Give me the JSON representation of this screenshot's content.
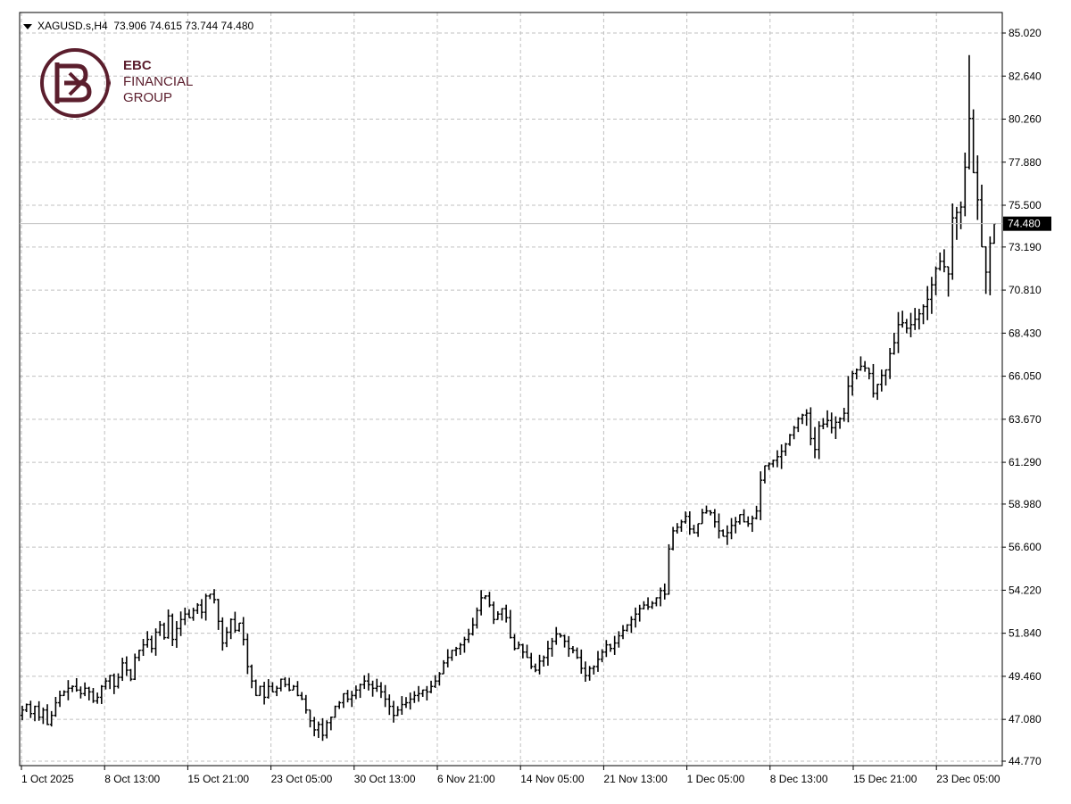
{
  "header": {
    "symbol": "XAGUSD.s,H4",
    "ohlc": "73.906 74.615 73.744 74.480"
  },
  "logo": {
    "line1": "EBC",
    "line2": "FINANCIAL",
    "line3": "GROUP",
    "color": "#5b1e2d"
  },
  "colors": {
    "bars": "#000000",
    "grid": "#c0c0c0",
    "price_line": "#c0c0c0",
    "price_label_bg": "#000000",
    "price_label_fg": "#ffffff"
  },
  "chart_data": {
    "type": "ohlc",
    "symbol": "XAGUSD.s",
    "timeframe": "H4",
    "ylim": [
      44.77,
      85.02
    ],
    "y_ticks": [
      "85.020",
      "82.640",
      "80.260",
      "77.880",
      "75.500",
      "73.190",
      "70.810",
      "68.430",
      "66.050",
      "63.670",
      "61.290",
      "58.980",
      "56.600",
      "54.220",
      "51.840",
      "49.460",
      "47.080",
      "44.770"
    ],
    "x_ticks": [
      "1 Oct 2025",
      "8 Oct 13:00",
      "15 Oct 21:00",
      "23 Oct 05:00",
      "30 Oct 13:00",
      "6 Nov 21:00",
      "14 Nov 05:00",
      "21 Nov 13:00",
      "1 Dec 05:00",
      "8 Dec 13:00",
      "15 Dec 21:00",
      "23 Dec 05:00"
    ],
    "current_price": "74.480",
    "grid": true,
    "closes": [
      47.6,
      47.9,
      47.4,
      47.8,
      47.2,
      47.6,
      46.8,
      47.3,
      48.0,
      48.4,
      48.6,
      48.8,
      48.9,
      48.7,
      48.5,
      48.8,
      48.6,
      48.1,
      48.3,
      48.9,
      49.2,
      49.5,
      48.9,
      49.4,
      50.2,
      49.8,
      49.3,
      50.5,
      50.9,
      51.2,
      51.5,
      51.0,
      51.9,
      52.3,
      51.6,
      52.8,
      51.5,
      52.1,
      52.6,
      52.9,
      52.7,
      53.1,
      53.4,
      53.0,
      53.9,
      54.0,
      53.7,
      52.5,
      51.3,
      51.9,
      52.6,
      52.0,
      52.4,
      51.5,
      50.0,
      49.2,
      48.4,
      48.9,
      48.3,
      48.9,
      48.6,
      48.8,
      49.3,
      49.0,
      48.7,
      48.9,
      48.4,
      48.2,
      47.6,
      47.0,
      46.5,
      46.8,
      46.2,
      46.9,
      47.2,
      47.8,
      48.0,
      48.5,
      48.2,
      48.4,
      48.7,
      49.0,
      49.2,
      49.0,
      48.8,
      48.9,
      48.6,
      48.2,
      47.8,
      47.3,
      47.6,
      47.9,
      48.0,
      48.2,
      48.4,
      48.5,
      48.7,
      48.6,
      48.9,
      49.2,
      49.6,
      50.2,
      50.5,
      50.9,
      51.0,
      51.2,
      51.5,
      51.8,
      52.3,
      53.1,
      53.8,
      53.9,
      53.4,
      52.6,
      52.9,
      53.2,
      52.7,
      51.6,
      51.0,
      51.2,
      50.8,
      50.5,
      50.0,
      49.8,
      50.3,
      50.5,
      51.0,
      51.4,
      51.8,
      51.7,
      51.4,
      51.0,
      50.9,
      50.5,
      49.9,
      49.5,
      49.9,
      50.0,
      50.4,
      50.8,
      51.2,
      51.0,
      51.3,
      51.7,
      52.0,
      52.3,
      52.6,
      52.9,
      53.2,
      53.4,
      53.3,
      53.5,
      53.8,
      54.2,
      54.0,
      56.5,
      57.5,
      57.7,
      58.0,
      58.3,
      57.6,
      57.4,
      57.9,
      58.5,
      58.6,
      58.5,
      58.0,
      57.5,
      57.2,
      57.4,
      57.8,
      58.0,
      58.4,
      58.0,
      57.9,
      58.2,
      58.6,
      60.3,
      61.1,
      61.2,
      61.4,
      61.6,
      61.9,
      62.3,
      62.8,
      63.2,
      63.7,
      63.9,
      64.0,
      62.6,
      62.0,
      63.3,
      63.4,
      63.6,
      63.2,
      63.5,
      63.7,
      64.0,
      65.5,
      66.2,
      66.4,
      66.6,
      66.5,
      66.2,
      65.1,
      65.6,
      66.1,
      66.4,
      67.3,
      67.9,
      68.9,
      69.0,
      68.7,
      68.9,
      69.2,
      69.5,
      69.9,
      70.3,
      71.1,
      72.0,
      72.4,
      72.1,
      71.7,
      74.8,
      75.1,
      75.4,
      77.6,
      80.3,
      77.3,
      75.8,
      73.2,
      71.8,
      73.4,
      74.48
    ]
  }
}
